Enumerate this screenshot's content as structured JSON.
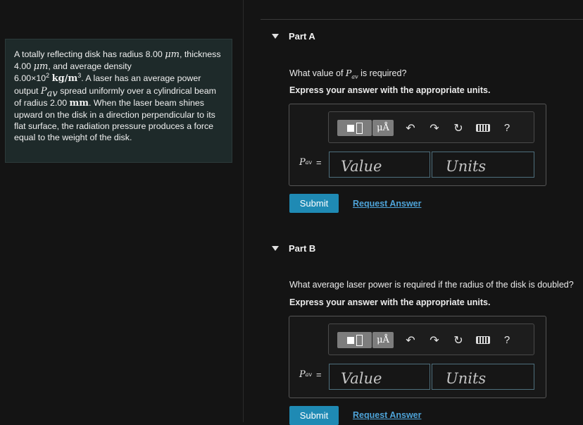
{
  "problem": {
    "text_a": "A totally reflecting disk has radius 8.00 ",
    "unit_um_1": "μm",
    "text_b": ", thickness 4.00 ",
    "unit_um_2": "μm",
    "text_c": ", and average density ",
    "density_mantissa": "6.00×10",
    "density_exp": "2",
    "density_unit": "kg/m",
    "density_unit_exp": "3",
    "text_d": ". A laser has an average power output ",
    "symbol_P": "P",
    "symbol_sub": "av",
    "text_e": " spread uniformly over a cylindrical beam of radius 2.00 ",
    "unit_mm": "mm",
    "text_f": ". When the laser beam shines upward on the disk in a direction perpendicular to its flat surface, the radiation pressure produces a force equal to the weight of the disk."
  },
  "parts": [
    {
      "header": "Part A",
      "question_pre": "What value of ",
      "question_symbol": "P",
      "question_sub": "av",
      "question_post": " is required?",
      "instruction": "Express your answer with the appropriate units.",
      "answer_symbol": "P",
      "answer_sub": "av",
      "equals": "=",
      "value_placeholder": "Value",
      "units_placeholder": "Units",
      "submit_label": "Submit",
      "request_label": "Request Answer"
    },
    {
      "header": "Part B",
      "question": "What average laser power is required if the radius of the disk is doubled?",
      "instruction": "Express your answer with the appropriate units.",
      "answer_symbol": "P",
      "answer_sub": "av",
      "equals": "=",
      "value_placeholder": "Value",
      "units_placeholder": "Units",
      "submit_label": "Submit",
      "request_label": "Request Answer"
    }
  ],
  "toolbar": {
    "units_label": "μÅ",
    "undo_glyph": "↶",
    "redo_glyph": "↷",
    "reset_glyph": "↻",
    "help_glyph": "?",
    "icons": [
      "templates-icon",
      "units-icon",
      "undo-icon",
      "redo-icon",
      "reset-icon",
      "keyboard-icon",
      "help-icon"
    ]
  },
  "colors": {
    "background": "#141414",
    "problem_panel": "#1e2a2a",
    "submit": "#1f8ab4",
    "link": "#4ea3d8",
    "input_border": "#4e6f7d"
  }
}
